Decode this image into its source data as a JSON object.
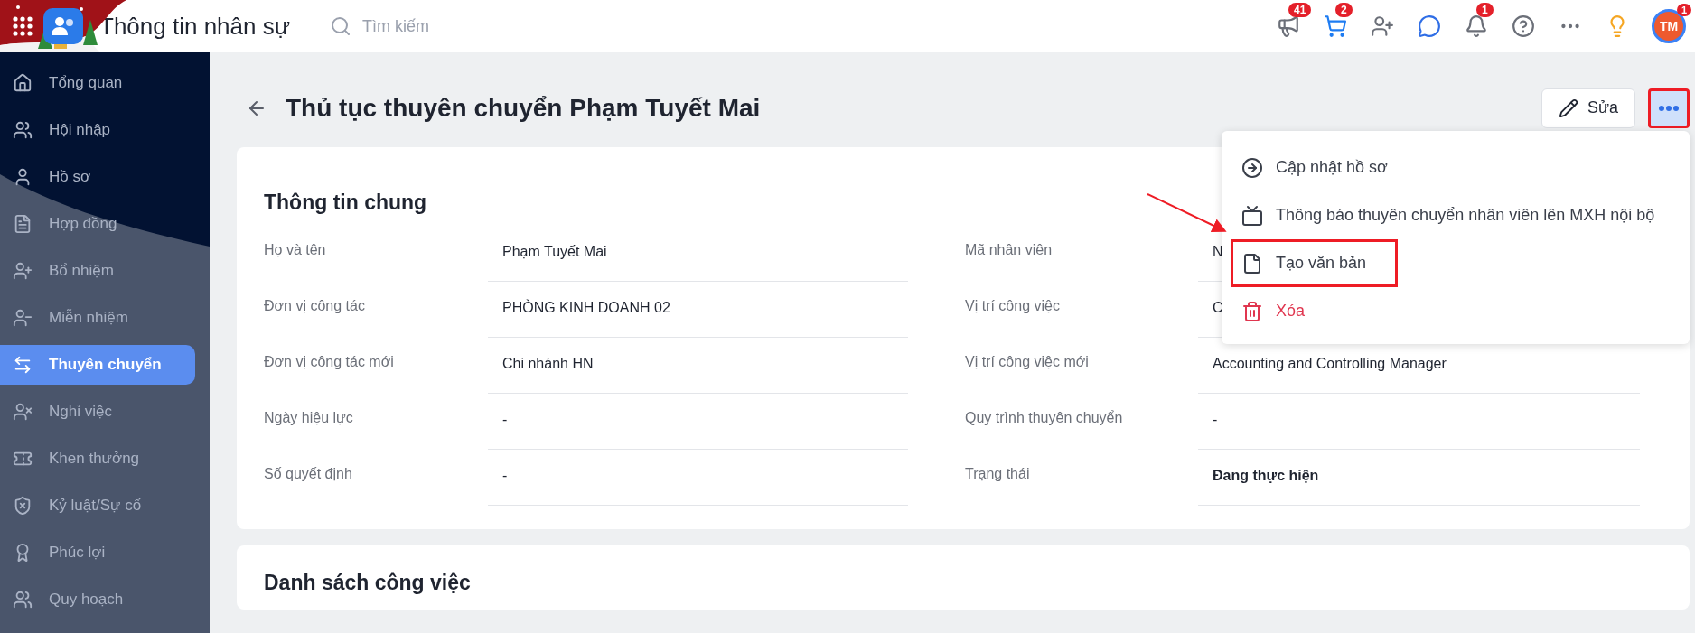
{
  "app": {
    "title": "Thông tin nhân sự",
    "search": {
      "placeholder": "Tìm kiếm"
    }
  },
  "header_icons": [
    {
      "kind": "megaphone",
      "badge": "41"
    },
    {
      "kind": "cart",
      "badge": "2"
    },
    {
      "kind": "add-user"
    },
    {
      "kind": "chat"
    },
    {
      "kind": "bell",
      "badge": "1"
    },
    {
      "kind": "help"
    },
    {
      "kind": "more"
    },
    {
      "kind": "idea"
    }
  ],
  "avatar": {
    "initials": "TM",
    "badge": "1"
  },
  "sidebar": {
    "items": [
      {
        "label": "Tổng quan",
        "selected": false
      },
      {
        "label": "Hội nhập",
        "selected": false
      },
      {
        "label": "Hồ sơ",
        "selected": false
      },
      {
        "label": "Hợp đồng",
        "selected": false
      },
      {
        "label": "Bổ nhiệm",
        "selected": false
      },
      {
        "label": "Miễn nhiệm",
        "selected": false
      },
      {
        "label": "Thuyên chuyển",
        "selected": true
      },
      {
        "label": "Nghỉ việc",
        "selected": false
      },
      {
        "label": "Khen thưởng",
        "selected": false
      },
      {
        "label": "Kỷ luật/Sự cố",
        "selected": false
      },
      {
        "label": "Phúc lợi",
        "selected": false
      },
      {
        "label": "Quy hoạch",
        "selected": false
      }
    ]
  },
  "page": {
    "title": "Thủ tục thuyên chuyển Phạm Tuyết Mai",
    "edit_button": "Sửa",
    "more_button": {
      "highlighted": true
    }
  },
  "menu": {
    "items": [
      {
        "label": "Cập nhật hồ sơ",
        "kind": "normal",
        "highlighted": false
      },
      {
        "label": "Thông báo thuyên chuyển nhân viên lên MXH nội bộ",
        "kind": "normal",
        "highlighted": false
      },
      {
        "label": "Tạo văn bản",
        "kind": "normal",
        "highlighted": true
      },
      {
        "label": "Xóa",
        "kind": "danger",
        "highlighted": false
      }
    ]
  },
  "general_info": {
    "heading": "Thông tin chung",
    "rows": [
      {
        "left": {
          "label": "Họ và tên",
          "value": "Phạm Tuyết Mai"
        },
        "right": {
          "label": "Mã nhân viên",
          "value": "N"
        }
      },
      {
        "left": {
          "label": "Đơn vị công tác",
          "value": "PHÒNG KINH DOANH 02"
        },
        "right": {
          "label": "Vị trí công việc",
          "value": "C"
        }
      },
      {
        "left": {
          "label": "Đơn vị công tác mới",
          "value": "Chi nhánh HN"
        },
        "right": {
          "label": "Vị trí công việc mới",
          "value": "Accounting and Controlling Manager"
        }
      },
      {
        "left": {
          "label": "Ngày hiệu lực",
          "value": "-"
        },
        "right": {
          "label": "Quy trình thuyên chuyển",
          "value": "-"
        }
      },
      {
        "left": {
          "label": "Số quyết định",
          "value": "-"
        },
        "right": {
          "label": "Trạng thái",
          "value": "Đang thực hiện"
        }
      }
    ]
  },
  "task_list": {
    "heading": "Danh sách công việc"
  }
}
